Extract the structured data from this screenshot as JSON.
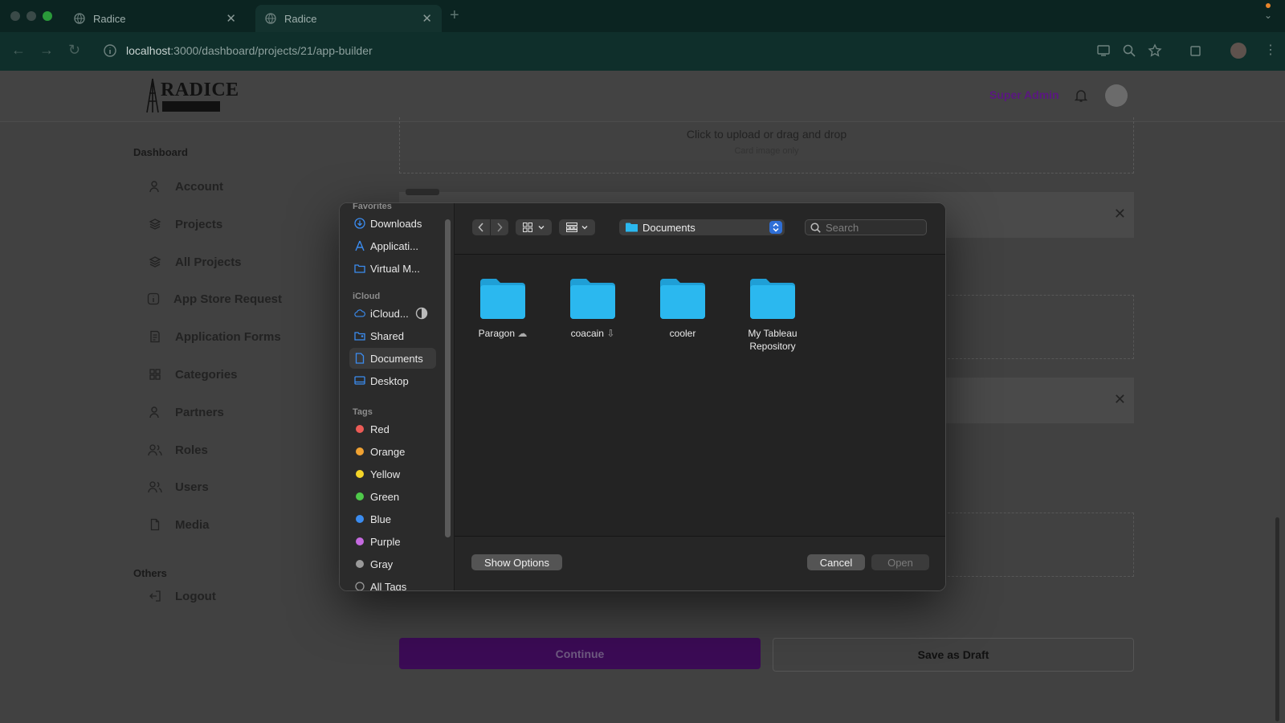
{
  "browser": {
    "tabs": [
      {
        "title": "Radice"
      },
      {
        "title": "Radice"
      }
    ],
    "url_host": "localhost",
    "url_path": ":3000/dashboard/projects/21/app-builder"
  },
  "header": {
    "logo_text": "RADICE",
    "user_label": "Super Admin"
  },
  "sidebar": {
    "dashboard_heading": "Dashboard",
    "items": [
      {
        "label": "Account",
        "icon": "user-icon"
      },
      {
        "label": "Projects",
        "icon": "layers-icon"
      },
      {
        "label": "All Projects",
        "icon": "layers-icon"
      },
      {
        "label": "App Store Request",
        "icon": "info-icon"
      },
      {
        "label": "Application Forms",
        "icon": "form-icon"
      },
      {
        "label": "Categories",
        "icon": "grid-icon"
      },
      {
        "label": "Partners",
        "icon": "user-icon"
      },
      {
        "label": "Roles",
        "icon": "users-icon"
      },
      {
        "label": "Users",
        "icon": "users-icon"
      },
      {
        "label": "Media",
        "icon": "file-icon"
      }
    ],
    "others_heading": "Others",
    "logout_label": "Logout"
  },
  "upload": {
    "title": "Click to upload or drag and drop",
    "subtitle": "Card image only"
  },
  "actions": {
    "continue_label": "Continue",
    "draft_label": "Save as Draft"
  },
  "finder": {
    "favorites_heading": "Favorites",
    "favorites": [
      "Downloads",
      "Applicati...",
      "Virtual M..."
    ],
    "icloud_heading": "iCloud",
    "icloud": [
      "iCloud...",
      "Shared",
      "Documents",
      "Desktop"
    ],
    "tags_heading": "Tags",
    "tags": [
      {
        "label": "Red",
        "color": "#ec5b56"
      },
      {
        "label": "Orange",
        "color": "#f0a232"
      },
      {
        "label": "Yellow",
        "color": "#f4d528"
      },
      {
        "label": "Green",
        "color": "#4fc94a"
      },
      {
        "label": "Blue",
        "color": "#3b8cf0"
      },
      {
        "label": "Purple",
        "color": "#c56ae0"
      },
      {
        "label": "Gray",
        "color": "#9a9a9a"
      }
    ],
    "all_tags_label": "All Tags",
    "location": "Documents",
    "search_placeholder": "Search",
    "files": [
      {
        "name": "Paragon",
        "badge": "cloud"
      },
      {
        "name": "coacain",
        "badge": "cloud-download"
      },
      {
        "name": "cooler",
        "badge": ""
      },
      {
        "name": "My Tableau Repository",
        "badge": ""
      }
    ],
    "show_options_label": "Show Options",
    "cancel_label": "Cancel",
    "open_label": "Open",
    "folder_color": "#2bb8ef"
  }
}
